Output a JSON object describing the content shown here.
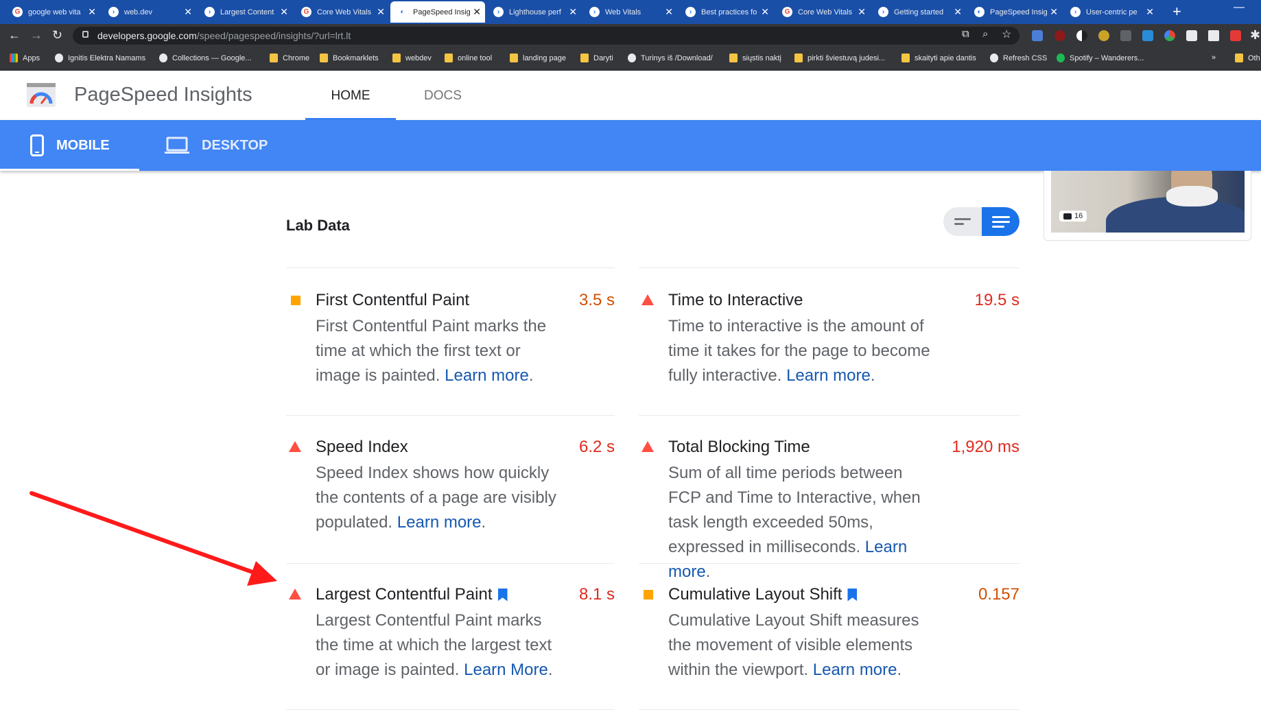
{
  "browser": {
    "tabs": [
      {
        "title": "google web vita",
        "icon": "google-icon"
      },
      {
        "title": "web.dev",
        "icon": "webdev-icon"
      },
      {
        "title": "Largest Content",
        "icon": "webdev-icon"
      },
      {
        "title": "Core Web Vitals",
        "icon": "google-icon"
      },
      {
        "title": "PageSpeed Insig",
        "icon": "pagespeed-icon"
      },
      {
        "title": "Lighthouse perf",
        "icon": "webdev-icon"
      },
      {
        "title": "Web Vitals",
        "icon": "webdev-icon"
      },
      {
        "title": "Best practices fo",
        "icon": "webdev-icon"
      },
      {
        "title": "Core Web Vitals",
        "icon": "google-icon"
      },
      {
        "title": "Getting started",
        "icon": "webdev-icon"
      },
      {
        "title": "PageSpeed Insig",
        "icon": "pagespeed-icon"
      },
      {
        "title": "User-centric pe",
        "icon": "webdev-icon"
      }
    ],
    "active_tab_index": 4,
    "url_host": "developers.google.com",
    "url_path": "/speed/pagespeed/insights/?url=lrt.lt",
    "bookmarks": [
      {
        "label": "Apps",
        "icon": "grid"
      },
      {
        "label": "Ignitis Elektra Namams",
        "icon": "circ"
      },
      {
        "label": "Collections — Google...",
        "icon": "circ"
      },
      {
        "label": "Chrome",
        "icon": "folder"
      },
      {
        "label": "Bookmarklets",
        "icon": "folder"
      },
      {
        "label": "webdev",
        "icon": "folder"
      },
      {
        "label": "online tool",
        "icon": "folder"
      },
      {
        "label": "landing page",
        "icon": "folder"
      },
      {
        "label": "Daryti",
        "icon": "folder"
      },
      {
        "label": "Turinys iš /Download/",
        "icon": "circ"
      },
      {
        "label": "siųstis naktį",
        "icon": "folder"
      },
      {
        "label": "pirkti šviestuvą judesi...",
        "icon": "folder"
      },
      {
        "label": "skaityti apie dantis",
        "icon": "folder"
      },
      {
        "label": "Refresh CSS",
        "icon": "circ"
      },
      {
        "label": "Spotify – Wanderers...",
        "icon": "green"
      },
      {
        "label": "»",
        "icon": "none"
      },
      {
        "label": "Oth",
        "icon": "folder"
      }
    ]
  },
  "psi": {
    "title": "PageSpeed Insights",
    "nav": {
      "home": "HOME",
      "docs": "DOCS"
    },
    "devices": {
      "mobile": "MOBILE",
      "desktop": "DESKTOP"
    },
    "screenshot_count": "16",
    "lab_title": "Lab Data",
    "metrics": [
      {
        "title": "First Contentful Paint",
        "value": "3.5 s",
        "rating": "average",
        "desc": "First Contentful Paint marks the time at which the first text or image is painted.",
        "link": "Learn more",
        "core": false
      },
      {
        "title": "Time to Interactive",
        "value": "19.5 s",
        "rating": "fail",
        "desc": "Time to interactive is the amount of time it takes for the page to become fully interactive.",
        "link": "Learn more",
        "core": false
      },
      {
        "title": "Speed Index",
        "value": "6.2 s",
        "rating": "fail",
        "desc": "Speed Index shows how quickly the contents of a page are visibly populated.",
        "link": "Learn more",
        "core": false
      },
      {
        "title": "Total Blocking Time",
        "value": "1,920 ms",
        "rating": "fail",
        "desc": "Sum of all time periods between FCP and Time to Interactive, when task length exceeded 50ms, expressed in milliseconds.",
        "link": "Learn more",
        "core": false
      },
      {
        "title": "Largest Contentful Paint",
        "value": "8.1 s",
        "rating": "fail",
        "desc": "Largest Contentful Paint marks the time at which the largest text or image is painted.",
        "link": "Learn More",
        "core": true
      },
      {
        "title": "Cumulative Layout Shift",
        "value": "0.157",
        "rating": "average",
        "desc": "Cumulative Layout Shift measures the movement of visible elements within the viewport.",
        "link": "Learn more",
        "core": true
      }
    ]
  },
  "colors": {
    "accent": "#4285f4",
    "fail": "#ff4e42",
    "average": "#ffa400",
    "annotation_arrow": "#ff1a1a"
  }
}
